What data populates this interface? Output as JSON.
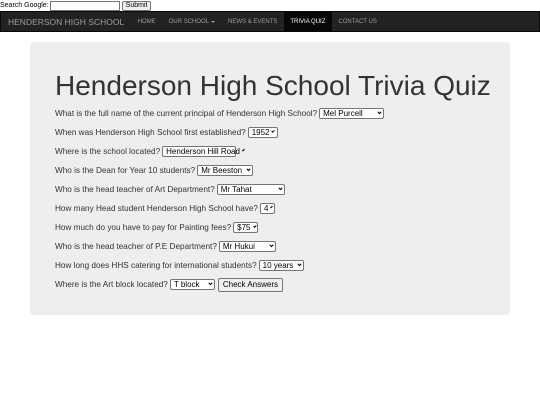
{
  "search": {
    "label": "Search Google:",
    "value": "",
    "submit_label": "Submit"
  },
  "nav": {
    "brand": "HENDERSON HIGH SCHOOL",
    "items": [
      {
        "label": "HOME"
      },
      {
        "label": "OUR SCHOOL"
      },
      {
        "label": "NEWS & EVENTS"
      },
      {
        "label": "TRIVIA QUIZ"
      },
      {
        "label": "CONTACT US"
      }
    ]
  },
  "quiz": {
    "title": "Henderson High School Trivia Quiz",
    "questions": [
      {
        "text": "What is the full name of the current principal of Henderson High School?",
        "answer": "Mel Purcell"
      },
      {
        "text": "When was Henderson High School first established?",
        "answer": "1952"
      },
      {
        "text": "Where is the school located?",
        "answer": "Henderson Hill Road"
      },
      {
        "text": "Who is the Dean for Year 10 students?",
        "answer": "Mr Beeston"
      },
      {
        "text": "Who is the head teacher of Art Department?",
        "answer": "Mr Tahat"
      },
      {
        "text": "How many Head student Henderson High School have?",
        "answer": "4"
      },
      {
        "text": "How much do you have to pay for Painting fees?",
        "answer": "$75"
      },
      {
        "text": "Who is the head teacher of P.E Department?",
        "answer": "Mr Hukui"
      },
      {
        "text": "How long does HHS catering for international students?",
        "answer": "10 years"
      },
      {
        "text": "Where is the Art block located?",
        "answer": "T block"
      }
    ],
    "check_label": "Check Answers"
  }
}
